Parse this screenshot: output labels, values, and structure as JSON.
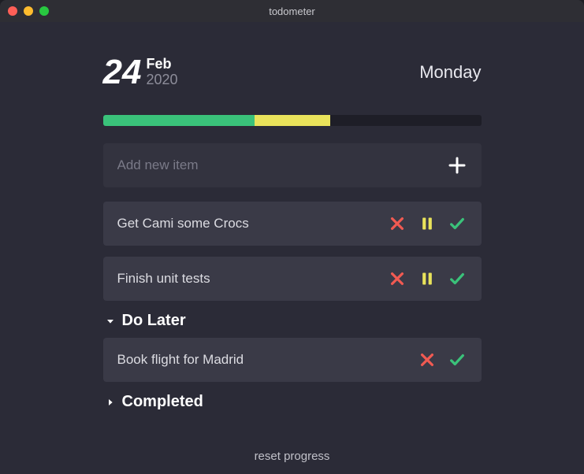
{
  "window": {
    "title": "todometer"
  },
  "date": {
    "day": "24",
    "month": "Feb",
    "year": "2020",
    "weekday": "Monday"
  },
  "progress": {
    "green_pct": 40,
    "yellow_pct": 20
  },
  "input": {
    "placeholder": "Add new item"
  },
  "pending": [
    {
      "text": "Get Cami some Crocs"
    },
    {
      "text": "Finish unit tests"
    }
  ],
  "sections": {
    "later_label": "Do Later",
    "completed_label": "Completed"
  },
  "later": [
    {
      "text": "Book flight for Madrid"
    }
  ],
  "footer": {
    "reset": "reset progress"
  },
  "colors": {
    "green": "#3ac27a",
    "yellow": "#e9e35b",
    "red": "#f15a52",
    "icon_white": "#ffffff"
  }
}
